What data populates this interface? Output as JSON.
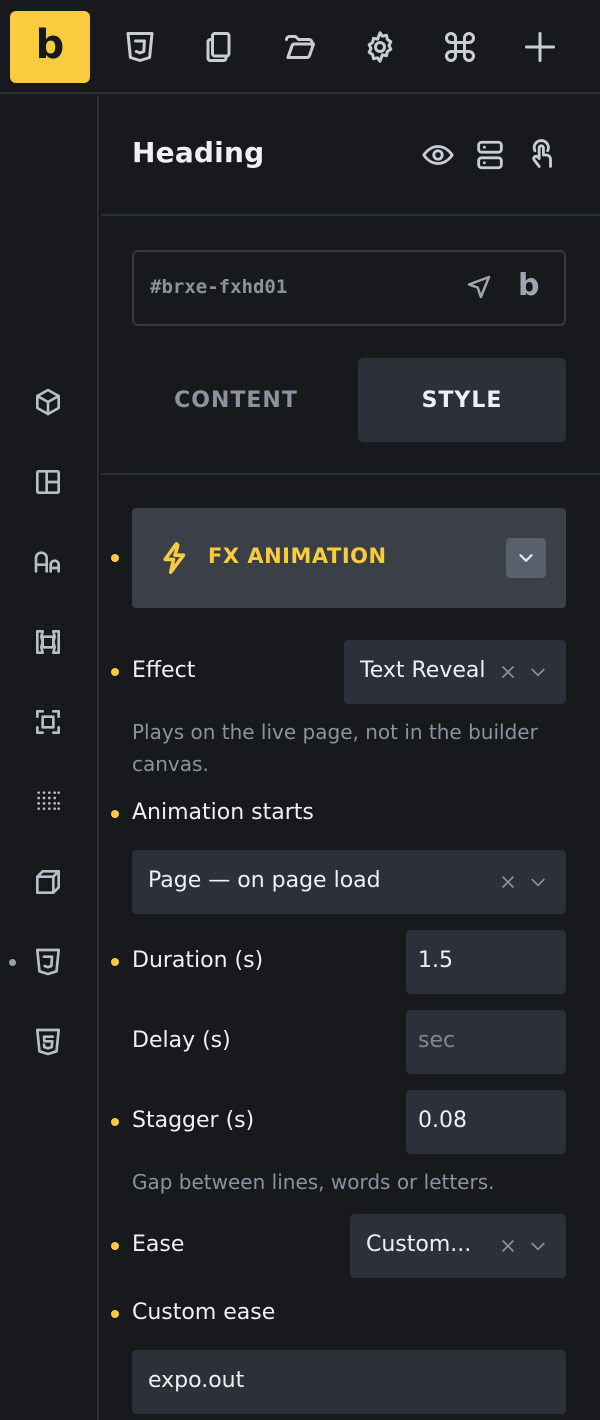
{
  "toolbar": {
    "logo": "b",
    "icons": [
      "css3-icon",
      "pages-icon",
      "folder-icon",
      "settings-icon",
      "command-icon",
      "add-icon"
    ]
  },
  "rail": {
    "icons": [
      "box-icon",
      "layout-icon",
      "typography-icon",
      "spacing-icon",
      "border-icon",
      "grid-dots-icon",
      "transform-icon",
      "css3-icon",
      "html5-icon"
    ]
  },
  "panel": {
    "title": "Heading",
    "element_id": "#brxe-fxhd01",
    "id_logo": "b",
    "tabs": {
      "content": "CONTENT",
      "style": "STYLE"
    }
  },
  "group": {
    "title": "FX ANIMATION"
  },
  "controls": {
    "effect": {
      "label": "Effect",
      "value": "Text Reveal"
    },
    "effect_hint": "Plays on the live page, not in the builder canvas.",
    "animation_starts": {
      "label": "Animation starts",
      "value": "Page — on page load"
    },
    "duration": {
      "label": "Duration (s)",
      "value": "1.5"
    },
    "delay": {
      "label": "Delay (s)",
      "placeholder": "sec"
    },
    "stagger": {
      "label": "Stagger (s)",
      "value": "0.08"
    },
    "stagger_hint": "Gap between lines, words or letters.",
    "ease": {
      "label": "Ease",
      "value": "Custom..."
    },
    "custom_ease": {
      "label": "Custom ease",
      "value": "expo.out"
    }
  },
  "colors": {
    "accent": "#f8cc3e",
    "background": "#17191d",
    "control_bg": "#2c3038",
    "group_bg": "#3a3f48"
  }
}
